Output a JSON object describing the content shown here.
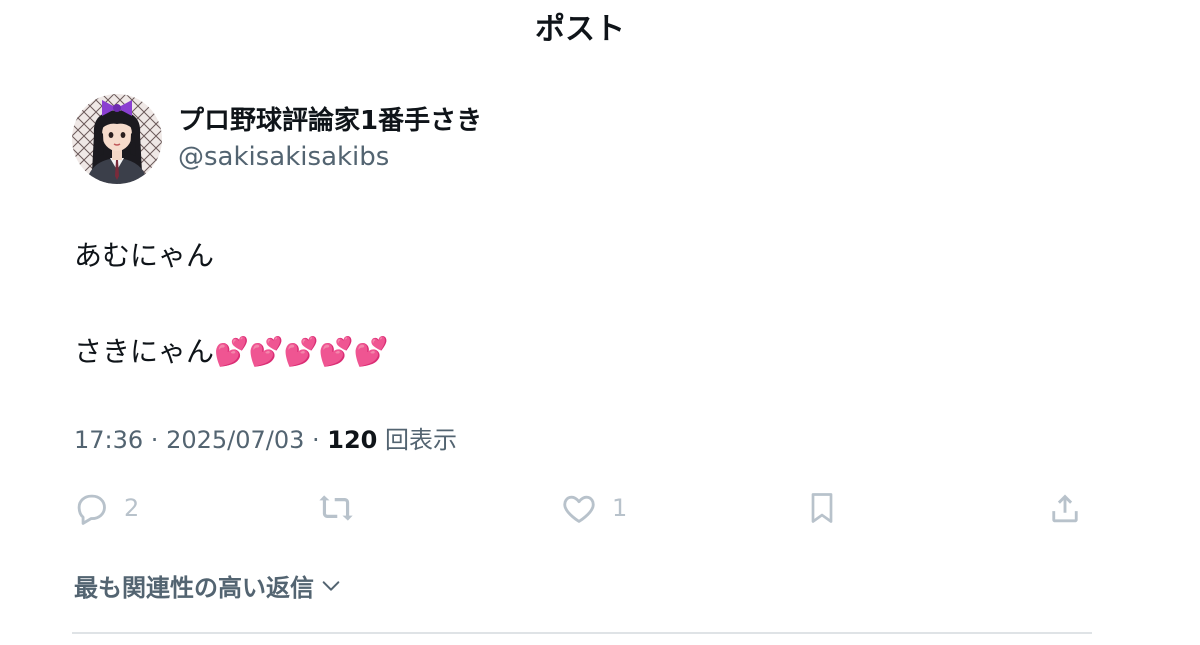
{
  "header": {
    "title": "ポスト"
  },
  "author": {
    "display_name": "プロ野球評論家1番手さき",
    "handle": "@sakisakisakibs",
    "avatar_icon": "avatar-illustration"
  },
  "post": {
    "line1": "あむにゃん",
    "line2": "さきにゃん💕💕💕💕💕"
  },
  "meta": {
    "time": "17:36",
    "separator": " · ",
    "date": "2025/07/03",
    "views_count": "120",
    "views_label": "回表示"
  },
  "actions": {
    "reply_count": "2",
    "like_count": "1",
    "icons": [
      "reply-icon",
      "repost-icon",
      "like-icon",
      "bookmark-icon",
      "share-icon"
    ]
  },
  "replies_filter": {
    "label": "最も関連性の高い返信"
  },
  "colors": {
    "text_primary": "#0f1419",
    "text_secondary": "#536471",
    "action_icon": "#b8c2cb",
    "divider": "#dfe3e6",
    "avatar_bow": "#8a3fd1"
  }
}
